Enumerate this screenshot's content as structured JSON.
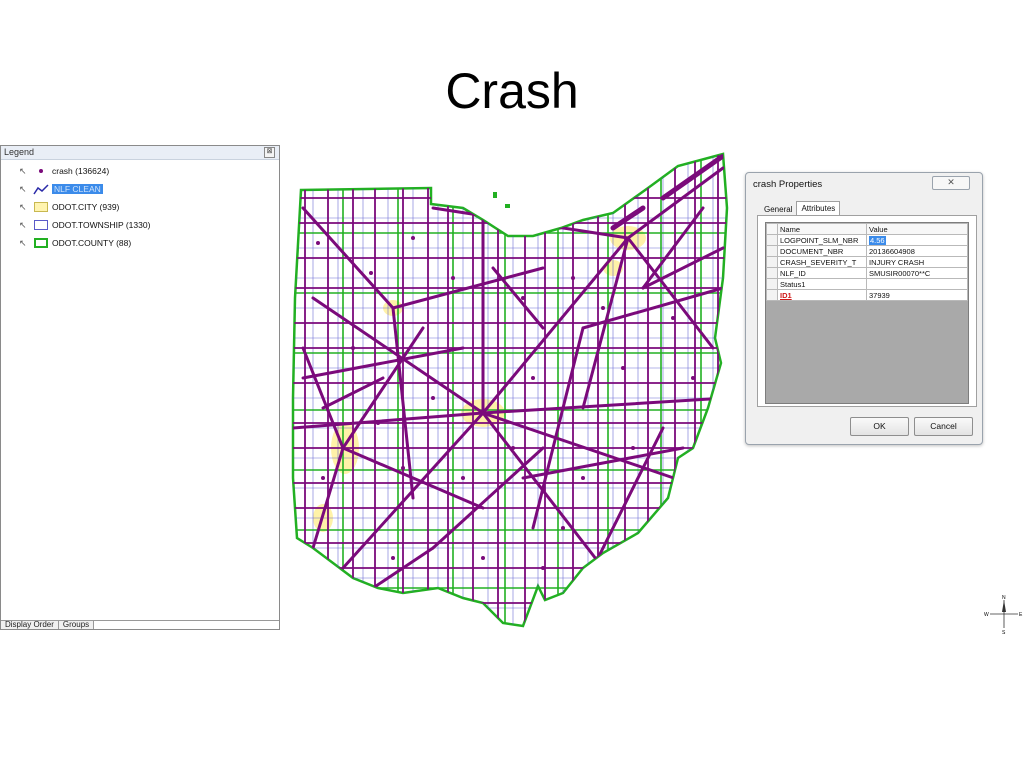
{
  "slide": {
    "title": "Crash"
  },
  "legend": {
    "title": "Legend",
    "items": [
      {
        "label": "crash (136624)",
        "symbol": "point",
        "color": "#7a0a7a",
        "selected": false
      },
      {
        "label": "NLF CLEAN",
        "symbol": "line",
        "color": "#2a2aa8",
        "selected": true
      },
      {
        "label": "ODOT.CITY (939)",
        "symbol": "fill",
        "color": "#fff4b0",
        "selected": false
      },
      {
        "label": "ODOT.TOWNSHIP (1330)",
        "symbol": "outline",
        "color": "#5a5ac8",
        "selected": false
      },
      {
        "label": "ODOT.COUNTY (88)",
        "symbol": "outline-thick",
        "color": "#22b022",
        "selected": false
      }
    ],
    "tabs": [
      "Display Order",
      "Groups"
    ]
  },
  "dialog": {
    "title": "crash Properties",
    "tabs": [
      "General",
      "Attributes"
    ],
    "active_tab": "Attributes",
    "columns": [
      "Name",
      "Value"
    ],
    "rows": [
      {
        "name": "LOGPOINT_SLM_NBR",
        "value": "4.56"
      },
      {
        "name": "DOCUMENT_NBR",
        "value": "20136604908"
      },
      {
        "name": "CRASH_SEVERITY_T",
        "value": "INJURY CRASH"
      },
      {
        "name": "NLF_ID",
        "value": "SMUSIR00070**C"
      },
      {
        "name": "Status1",
        "value": ""
      },
      {
        "name": "ID1",
        "value": "37939"
      }
    ],
    "ok_label": "OK",
    "cancel_label": "Cancel"
  },
  "map": {
    "colors": {
      "roads": "#7b0a7b",
      "county": "#22b022",
      "township": "#4a4acc",
      "city": "#fff2a8"
    }
  },
  "compass": {
    "n": "N",
    "s": "S",
    "e": "E",
    "w": "W"
  }
}
